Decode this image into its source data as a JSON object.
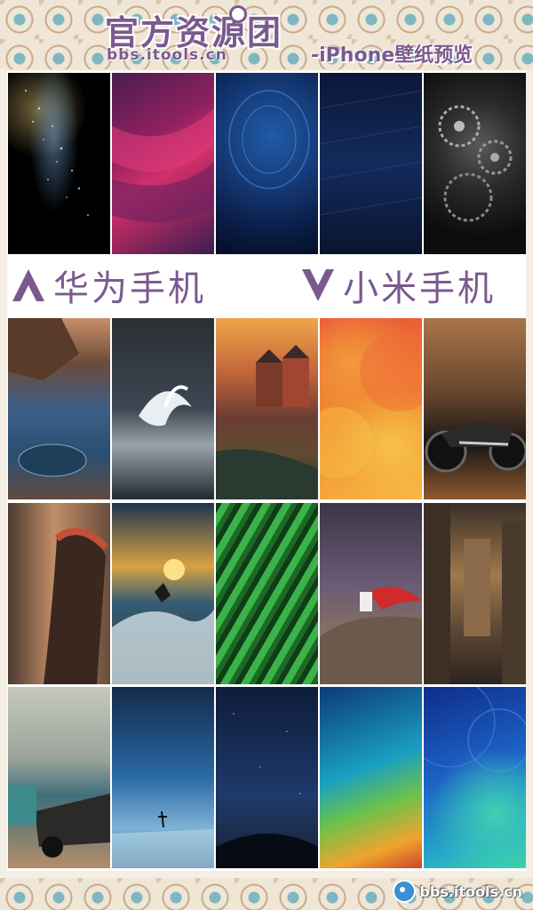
{
  "header": {
    "brand": "官方资源团",
    "url": "bbs.itools.cn",
    "subtitle": "-iPhone壁纸预览"
  },
  "sections": {
    "huawei": "华为手机",
    "xiaomi": "小米手机"
  },
  "footer": {
    "logo_text": "bbs.itools.cn"
  },
  "colors": {
    "accent": "#7a5a8e"
  }
}
